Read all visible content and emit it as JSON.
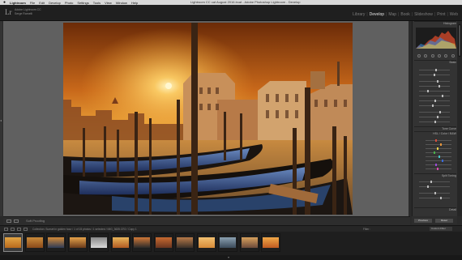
{
  "menubar": {
    "app_name": "Lightroom",
    "items": [
      "File",
      "Edit",
      "Develop",
      "Photo",
      "Settings",
      "Tools",
      "View",
      "Window",
      "Help"
    ],
    "window_title": "Lightroom CC cat August 2016.lrcat - Adobe Photoshop Lightroom - Develop"
  },
  "identity": {
    "logo": "Lr",
    "line1": "Adobe Lightroom CC",
    "line2": "Serge Ramelli"
  },
  "modules": {
    "items": [
      {
        "label": "Library",
        "active": false
      },
      {
        "label": "Develop",
        "active": true
      },
      {
        "label": "Map",
        "active": false
      },
      {
        "label": "Book",
        "active": false
      },
      {
        "label": "Slideshow",
        "active": false
      },
      {
        "label": "Print",
        "active": false
      },
      {
        "label": "Web",
        "active": false
      }
    ],
    "separator": "|"
  },
  "right_panel": {
    "histogram_label": "Histogram",
    "basic_label": "Basic",
    "tone_curve_label": "Tone Curve",
    "hsl_label": "HSL / Color / B&W",
    "split_toning_label": "Split Toning",
    "detail_label": "Detail",
    "previous_button": "Previous",
    "reset_button": "Reset"
  },
  "toolbar": {
    "soft_proofing_label": "Soft Proofing"
  },
  "filmbar": {
    "breadcrumb": "Collection: Sunset in golden hour  /  1 of 15 photos / 1 selected / IMG_3635.CR2 / Copy 1",
    "filter_label": "Filter :",
    "filter_value": "Custom Filter"
  },
  "filmstrip": {
    "selected_index": 0,
    "thumb_colors": [
      [
        "#b86a1c",
        "#e3a544"
      ],
      [
        "#8a4a1a",
        "#c98a3a"
      ],
      [
        "#2e3b55",
        "#d28a3a"
      ],
      [
        "#6a3a1a",
        "#e6a24a"
      ],
      [
        "#d9d9d9",
        "#888888"
      ],
      [
        "#b05a22",
        "#e8b45a"
      ],
      [
        "#2a2a2a",
        "#d07838"
      ],
      [
        "#6a3520",
        "#c86a30"
      ],
      [
        "#3a3028",
        "#b87a48"
      ],
      [
        "#d68a38",
        "#f2c070"
      ],
      [
        "#3b4a5a",
        "#8aa0b0"
      ],
      [
        "#6c4a3a",
        "#d7a05c"
      ],
      [
        "#c05a20",
        "#f0a848"
      ]
    ]
  }
}
